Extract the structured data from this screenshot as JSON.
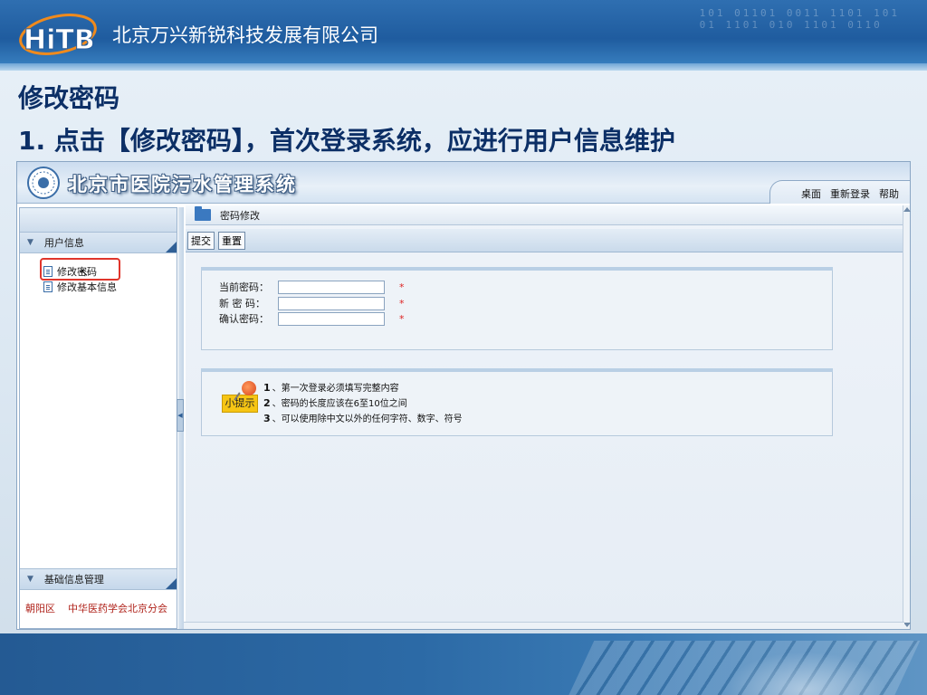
{
  "banner": {
    "logo_text": "HiTB",
    "company_name": "北京万兴新锐科技发展有限公司",
    "binary_decor": "101 01101 0011 1101 101\n01 1101 010 1101 0110"
  },
  "slide": {
    "title": "修改密码",
    "step": "1. 点击【修改密码】，首次登录系统，应进行用户信息维护"
  },
  "app": {
    "title": "北京市医院污水管理系统",
    "tabs": [
      "桌面",
      "重新登录",
      "帮助"
    ],
    "sidebar": {
      "user_section": "用户信息",
      "items": [
        "修改密码",
        "修改基本信息"
      ],
      "basic_section": "基础信息管理",
      "footer": [
        "朝阳区",
        "中华医药学会北京分会"
      ]
    },
    "breadcrumb": "密码修改",
    "toolbar": {
      "submit": "提交",
      "reset": "重置"
    },
    "form": {
      "current_password": {
        "label": "当前密码：",
        "value": "",
        "required": "*"
      },
      "new_password": {
        "label": "新 密 码：",
        "value": "",
        "required": "*"
      },
      "confirm_password": {
        "label": "确认密码：",
        "value": "",
        "required": "*"
      }
    },
    "tips": {
      "icon_label": "小提示",
      "lines": [
        {
          "num": "1",
          "text": "、第一次登录必须填写完整内容"
        },
        {
          "num": "2",
          "text": "、密码的长度应该在6至10位之间"
        },
        {
          "num": "3",
          "text": "、可以使用除中文以外的任何字符、数字、符号"
        }
      ]
    }
  },
  "colors": {
    "banner_blue": "#1f5c9f",
    "heading_navy": "#0c2f66",
    "highlight_red": "#e0352b",
    "required_red": "#dd2222"
  }
}
